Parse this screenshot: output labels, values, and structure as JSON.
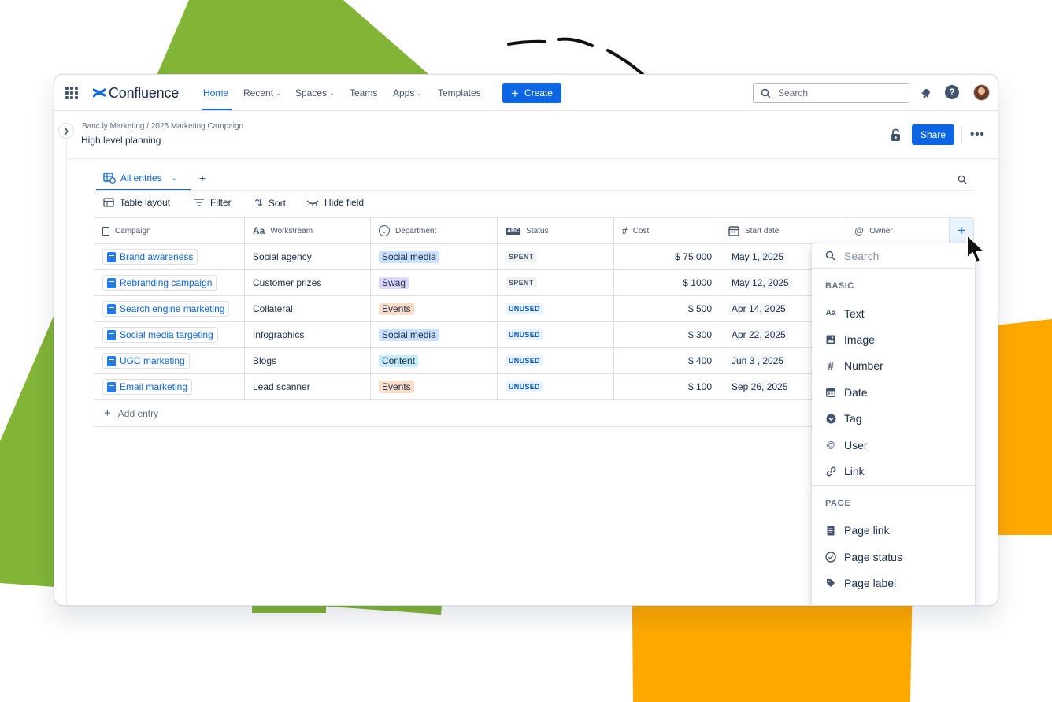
{
  "nav": {
    "logo_text": "Confluence",
    "home": "Home",
    "recent": "Recent",
    "spaces": "Spaces",
    "teams": "Teams",
    "apps": "Apps",
    "templates": "Templates",
    "create": "Create",
    "search_placeholder": "Search"
  },
  "page": {
    "breadcrumb": "Banc.ly Marketing  /  2025 Marketing Campaign",
    "title": "High level planning",
    "share": "Share"
  },
  "database": {
    "view_tab": "All entries",
    "tools": {
      "layout": "Table layout",
      "filter": "Filter",
      "sort": "Sort",
      "hide": "Hide field"
    },
    "columns": [
      "Campaign",
      "Workstream",
      "Department",
      "Status",
      "Cost",
      "Start date",
      "Owner"
    ],
    "rows": [
      {
        "campaign": "Brand awareness",
        "workstream": "Social agency",
        "department": "Social media",
        "status": "SPENT",
        "cost": "$ 75 000",
        "start": "May 1, 2025"
      },
      {
        "campaign": "Rebranding campaign",
        "workstream": "Customer prizes",
        "department": "Swag",
        "status": "SPENT",
        "cost": "$ 1000",
        "start": "May 12, 2025"
      },
      {
        "campaign": "Search engine marketing",
        "workstream": "Collateral",
        "department": "Events",
        "status": "UNUSED",
        "cost": "$ 500",
        "start": "Apr 14, 2025"
      },
      {
        "campaign": "Social media targeting",
        "workstream": "Infographics",
        "department": "Social media",
        "status": "UNUSED",
        "cost": "$ 300",
        "start": "Apr 22, 2025"
      },
      {
        "campaign": "UGC marketing",
        "workstream": "Blogs",
        "department": "Content",
        "status": "UNUSED",
        "cost": "$ 400",
        "start": "Jun 3 , 2025"
      },
      {
        "campaign": "Email marketing",
        "workstream": "Lead scanner",
        "department": "Events",
        "status": "UNUSED",
        "cost": "$ 100",
        "start": "Sep 26, 2025"
      }
    ],
    "add_entry": "Add entry",
    "department_colors": {
      "Social media": {
        "bg": "#cce0ff",
        "fg": "#172b4d"
      },
      "Swag": {
        "bg": "#dfd8fd",
        "fg": "#172b4d"
      },
      "Events": {
        "bg": "#fedec8",
        "fg": "#172b4d"
      },
      "Content": {
        "bg": "#c6edfb",
        "fg": "#172b4d"
      }
    }
  },
  "field_menu": {
    "search_placeholder": "Search",
    "basic_label": "BASIC",
    "basic_items": [
      {
        "label": "Text",
        "icon": "text-format-icon"
      },
      {
        "label": "Image",
        "icon": "image-icon"
      },
      {
        "label": "Number",
        "icon": "hash-icon"
      },
      {
        "label": "Date",
        "icon": "calendar-icon"
      },
      {
        "label": "Tag",
        "icon": "tag-chevron-icon"
      },
      {
        "label": "User",
        "icon": "at-sign-icon"
      },
      {
        "label": "Link",
        "icon": "link-icon"
      }
    ],
    "page_label": "PAGE",
    "page_items": [
      {
        "label": "Page link",
        "icon": "page-icon"
      },
      {
        "label": "Page status",
        "icon": "check-circle-icon"
      },
      {
        "label": "Page label",
        "icon": "label-tag-icon"
      }
    ]
  },
  "colors": {
    "brand_blue": "#0c66e4",
    "green_shape": "#82b536",
    "orange_shape": "#ffa900"
  }
}
